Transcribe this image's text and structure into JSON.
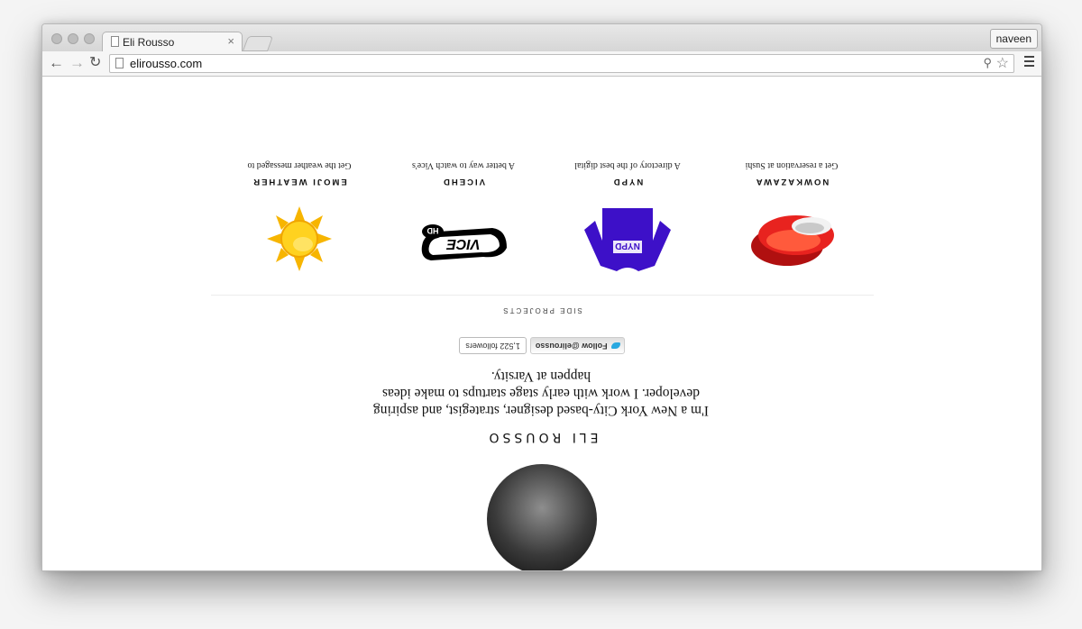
{
  "browser": {
    "tab_title": "Eli Rousso",
    "tab_close": "×",
    "user_button": "naveen",
    "url": "elirousso.com",
    "icons": [
      "back-arrow-icon",
      "forward-arrow-icon",
      "reload-icon",
      "page-icon",
      "zoom-icon",
      "star-icon",
      "menu-icon"
    ]
  },
  "profile": {
    "name": "ELI ROUSSO",
    "bio": "I'm a New York City-based designer, strategist, and aspiring developer. I work with early stage startups to make ideas happen at Varsity.",
    "follow_label": "Follow @elirousso",
    "followers": "1,522 followers"
  },
  "side_projects": {
    "label": "SIDE PROJECTS",
    "items": [
      {
        "title": "NOWKAZAWA",
        "desc": "Get a reservation at Sushi",
        "icon": "sushi-icon"
      },
      {
        "title": "VICEHD",
        "desc": "A better way to watch Vice's",
        "icon": "vice-hd-logo-icon"
      },
      {
        "title": "NYPD",
        "desc": "A directory of the best digital",
        "icon": "nypd-sweater-icon"
      },
      {
        "title": "EMOJI WEATHER",
        "desc": "Get the weather messaged to",
        "icon": "sun-emoji-icon"
      }
    ]
  },
  "colors": {
    "sun": "#f7b500",
    "sushi": "#e8231f",
    "nypd": "#3d10c8",
    "twitter": "#2aa9e0"
  }
}
